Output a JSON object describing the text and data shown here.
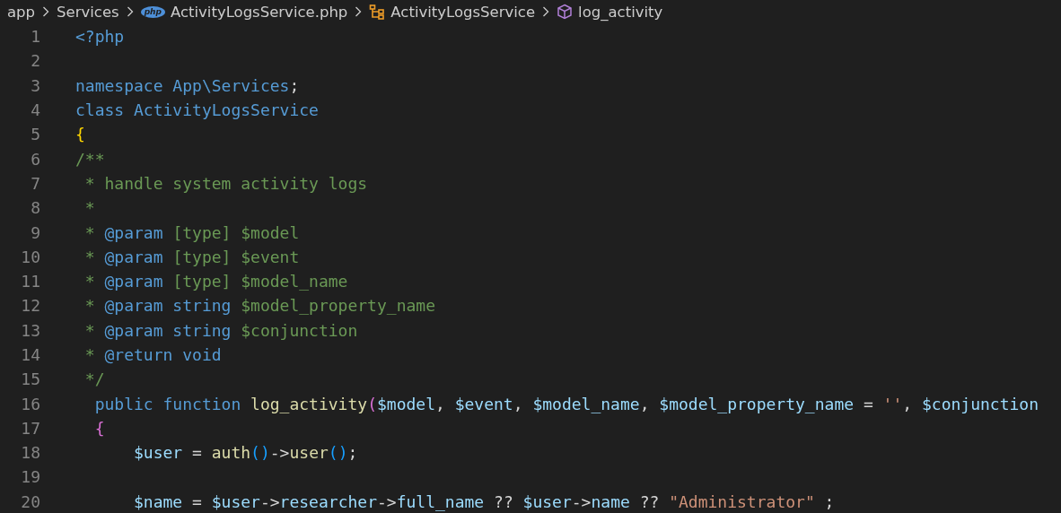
{
  "breadcrumb": [
    {
      "label": "app",
      "kind": "folder"
    },
    {
      "label": "Services",
      "kind": "folder"
    },
    {
      "label": "ActivityLogsService.php",
      "kind": "file",
      "icon_text": "php"
    },
    {
      "label": "ActivityLogsService",
      "kind": "class"
    },
    {
      "label": "log_activity",
      "kind": "method"
    }
  ],
  "lines": [
    {
      "number": "1",
      "tokens": [
        {
          "kind": "keyword",
          "t": "<?php"
        }
      ]
    },
    {
      "number": "2"
    },
    {
      "number": "3",
      "tokens": [
        {
          "kind": "keyword",
          "t": "namespace App\\Services"
        },
        {
          "kind": "punctuation",
          "t": ";"
        }
      ]
    },
    {
      "number": "4",
      "tokens": [
        {
          "kind": "keyword",
          "t": "class ActivityLogsService"
        }
      ]
    },
    {
      "number": "5",
      "tokens": [
        {
          "kind": "bracket1",
          "t": "{"
        }
      ]
    },
    {
      "number": "6",
      "tokens": [
        {
          "kind": "comment",
          "t": "/**"
        }
      ]
    },
    {
      "number": "7",
      "tokens": [
        {
          "kind": "comment",
          "t": " * handle system activity logs"
        }
      ]
    },
    {
      "number": "8",
      "tokens": [
        {
          "kind": "comment",
          "t": " *"
        }
      ]
    },
    {
      "number": "9",
      "tokens": [
        {
          "kind": "comment",
          "t": " * "
        },
        {
          "kind": "keyword",
          "t": "@param"
        },
        {
          "kind": "comment",
          "t": " [type] $model"
        }
      ]
    },
    {
      "number": "10",
      "tokens": [
        {
          "kind": "comment",
          "t": " * "
        },
        {
          "kind": "keyword",
          "t": "@param"
        },
        {
          "kind": "comment",
          "t": " [type] $event"
        }
      ]
    },
    {
      "number": "11",
      "tokens": [
        {
          "kind": "comment",
          "t": " * "
        },
        {
          "kind": "keyword",
          "t": "@param"
        },
        {
          "kind": "comment",
          "t": " [type] $model_name"
        }
      ]
    },
    {
      "number": "12",
      "tokens": [
        {
          "kind": "comment",
          "t": " * "
        },
        {
          "kind": "keyword",
          "t": "@param string"
        },
        {
          "kind": "comment",
          "t": " $model_property_name"
        }
      ]
    },
    {
      "number": "13",
      "tokens": [
        {
          "kind": "comment",
          "t": " * "
        },
        {
          "kind": "keyword",
          "t": "@param string"
        },
        {
          "kind": "comment",
          "t": " $conjunction"
        }
      ]
    },
    {
      "number": "14",
      "tokens": [
        {
          "kind": "comment",
          "t": " * "
        },
        {
          "kind": "keyword",
          "t": "@return void"
        }
      ]
    },
    {
      "number": "15",
      "tokens": [
        {
          "kind": "comment",
          "t": " */"
        }
      ]
    },
    {
      "number": "16",
      "tokens": [
        {
          "kind": "keyword",
          "t": "  public function "
        },
        {
          "kind": "function",
          "t": "log_activity"
        },
        {
          "kind": "bracket2",
          "t": "("
        },
        {
          "kind": "variable",
          "t": "$model"
        },
        {
          "kind": "punctuation",
          "t": ", "
        },
        {
          "kind": "variable",
          "t": "$event"
        },
        {
          "kind": "punctuation",
          "t": ", "
        },
        {
          "kind": "variable",
          "t": "$model_name"
        },
        {
          "kind": "punctuation",
          "t": ", "
        },
        {
          "kind": "variable",
          "t": "$model_property_name"
        },
        {
          "kind": "punctuation",
          "t": " = "
        },
        {
          "kind": "string",
          "t": "''"
        },
        {
          "kind": "punctuation",
          "t": ", "
        },
        {
          "kind": "variable",
          "t": "$conjunction"
        }
      ]
    },
    {
      "number": "17",
      "tokens": [
        {
          "kind": "bracket2",
          "t": "  {"
        }
      ]
    },
    {
      "number": "18",
      "tokens": [
        {
          "kind": "variable",
          "t": "      $user"
        },
        {
          "kind": "punctuation",
          "t": " = "
        },
        {
          "kind": "function",
          "t": "auth"
        },
        {
          "kind": "bracket3",
          "t": "()"
        },
        {
          "kind": "punctuation",
          "t": "->"
        },
        {
          "kind": "function",
          "t": "user"
        },
        {
          "kind": "bracket3",
          "t": "()"
        },
        {
          "kind": "punctuation",
          "t": ";"
        }
      ]
    },
    {
      "number": "19"
    },
    {
      "number": "20",
      "tokens": [
        {
          "kind": "variable",
          "t": "      $name"
        },
        {
          "kind": "punctuation",
          "t": " = "
        },
        {
          "kind": "variable",
          "t": "$user"
        },
        {
          "kind": "punctuation",
          "t": "->"
        },
        {
          "kind": "variable",
          "t": "researcher"
        },
        {
          "kind": "punctuation",
          "t": "->"
        },
        {
          "kind": "variable",
          "t": "full_name"
        },
        {
          "kind": "punctuation",
          "t": " ?? "
        },
        {
          "kind": "variable",
          "t": "$user"
        },
        {
          "kind": "punctuation",
          "t": "->"
        },
        {
          "kind": "variable",
          "t": "name"
        },
        {
          "kind": "punctuation",
          "t": " ?? "
        },
        {
          "kind": "string",
          "t": "\"Administrator\""
        },
        {
          "kind": "punctuation",
          "t": " ;"
        }
      ]
    }
  ]
}
